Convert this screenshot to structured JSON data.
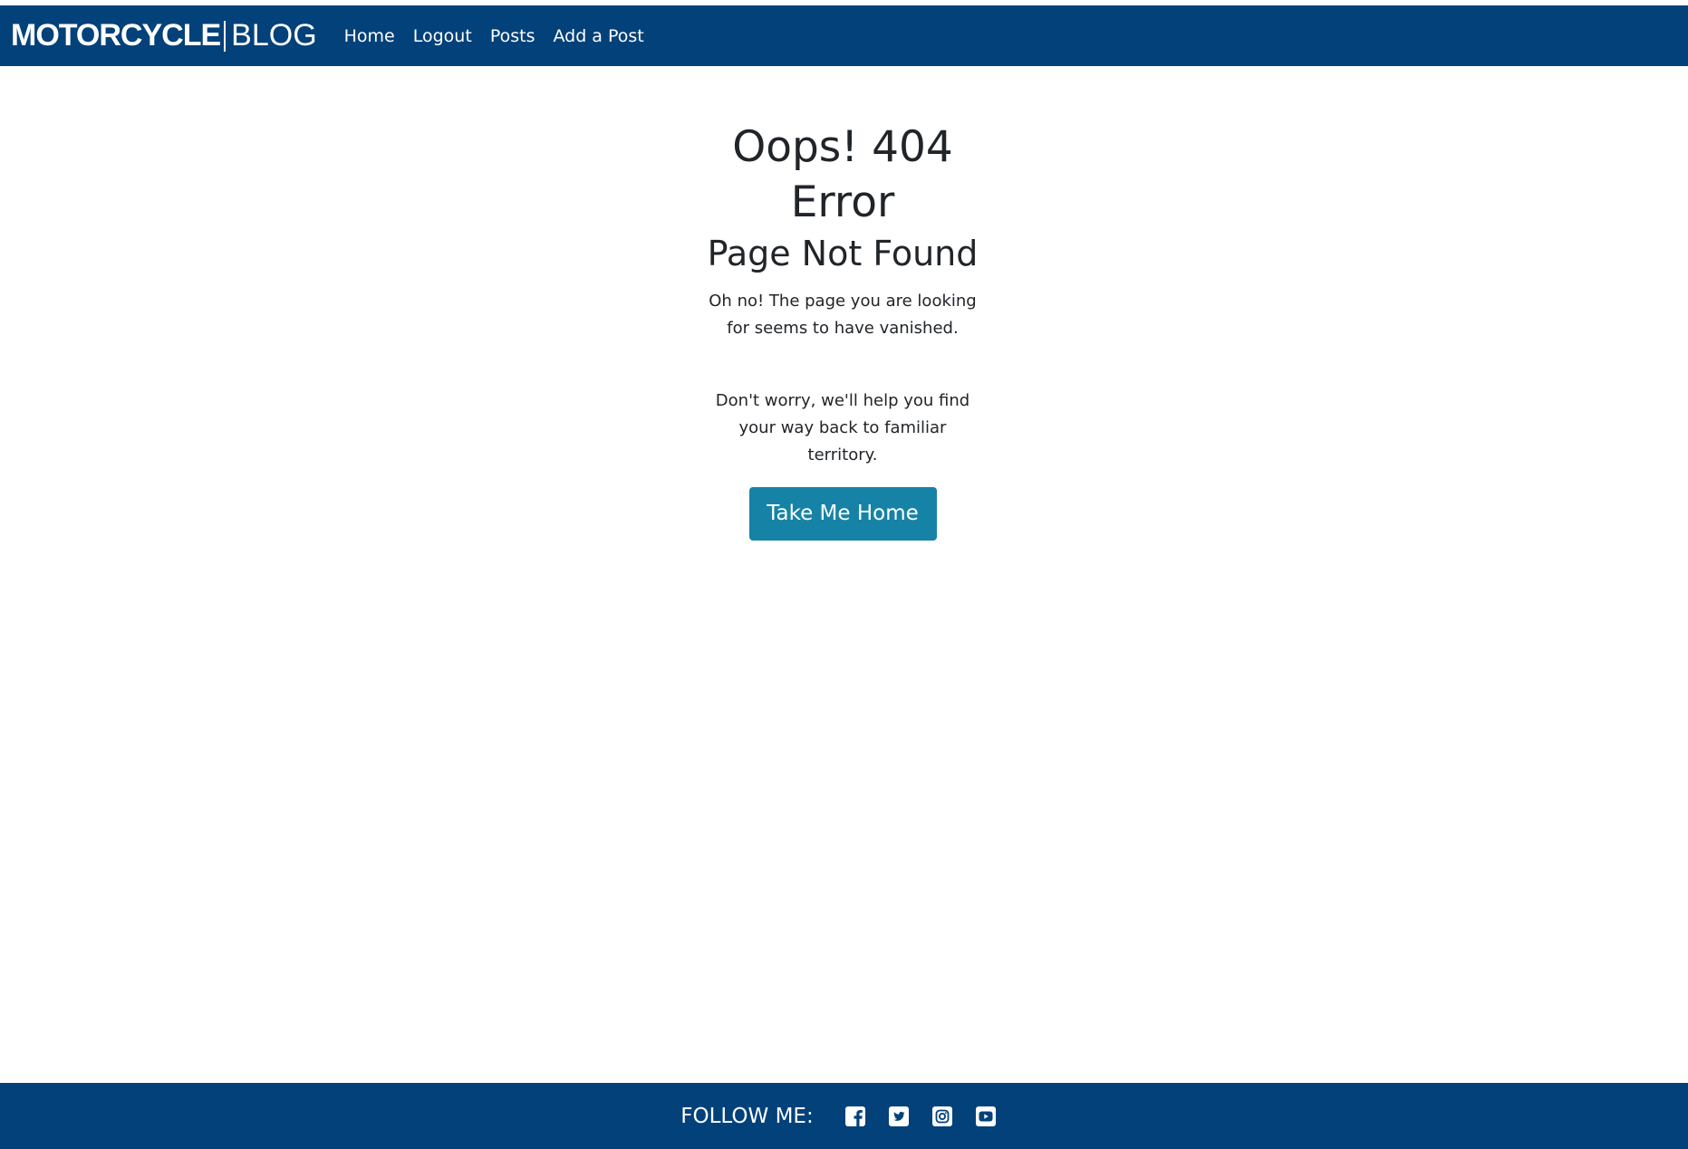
{
  "navbar": {
    "brand_bold": "MOTORCYCLE",
    "brand_light": "BLOG",
    "links": [
      {
        "label": "Home"
      },
      {
        "label": "Logout"
      },
      {
        "label": "Posts"
      },
      {
        "label": "Add a Post"
      }
    ]
  },
  "error": {
    "title": "Oops! 404 Error",
    "subtitle": "Page Not Found",
    "message1": "Oh no! The page you are looking for seems to have vanished.",
    "message2": "Don't worry, we'll help you find your way back to familiar territory.",
    "button_label": "Take Me Home"
  },
  "footer": {
    "follow_label": "FOLLOW ME:",
    "social_icons": [
      "facebook-icon",
      "twitter-icon",
      "instagram-icon",
      "youtube-icon"
    ]
  },
  "colors": {
    "navbar_bg": "#03417a",
    "button_bg": "#1683a6",
    "text": "#212529"
  }
}
